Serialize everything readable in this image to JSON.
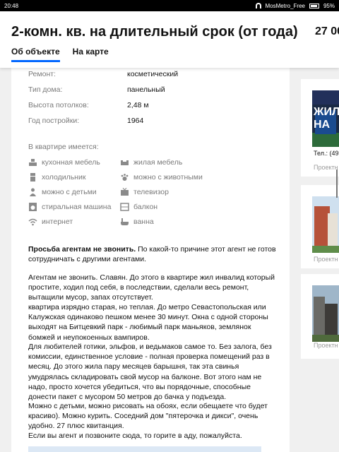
{
  "statusbar": {
    "time": "20:48",
    "network": "MosMetro_Free",
    "battery": "95%"
  },
  "header": {
    "title": "2-комн. кв. на длительный срок (от года)",
    "price": "27 00",
    "tabs": [
      {
        "label": "Об объекте"
      },
      {
        "label": "На карте"
      }
    ]
  },
  "details": [
    {
      "key": "Ремонт:",
      "value": "косметический"
    },
    {
      "key": "Тип дома:",
      "value": "панельный"
    },
    {
      "key": "Высота потолков:",
      "value": "2,48 м"
    },
    {
      "key": "Год постройки:",
      "value": "1964"
    }
  ],
  "amenities_title": "В квартире имеется:",
  "amenities": [
    {
      "label": "кухонная мебель",
      "icon": "kitchen-icon",
      "present": false
    },
    {
      "label": "жилая мебель",
      "icon": "sofa-icon",
      "present": false
    },
    {
      "label": "холодильник",
      "icon": "fridge-icon",
      "present": false
    },
    {
      "label": "можно с животными",
      "icon": "paw-icon",
      "present": false
    },
    {
      "label": "можно с детьми",
      "icon": "child-icon",
      "present": false
    },
    {
      "label": "телевизор",
      "icon": "tv-icon",
      "present": false
    },
    {
      "label": "стиральная машина",
      "icon": "washer-icon",
      "present": false
    },
    {
      "label": "балкон",
      "icon": "balcony-icon",
      "present": false
    },
    {
      "label": "интернет",
      "icon": "wifi-icon",
      "present": false
    },
    {
      "label": "ванна",
      "icon": "bathtub-icon",
      "present": false
    }
  ],
  "description": {
    "warning_bold": "Просьба агентам не звонить.",
    "warning_rest": " По какой-то причине этот агент не готов сотрудничать с другими агентами.",
    "paragraphs": [
      "Агентам не звонить. Славян. До этого в квартире жил инвалид который простите, ходил под себя, в последствии, сделали весь ремонт, вытащили мусор, запах отсутствует.",
      "квартира изрядно старая, но теплая. До метро Севастопольская или Калужская одинаково пешком менее 30 минут. Окна с одной стороны выходят на Битцевкий парк - любимый парк маньяков, землянок бомжей и неупокоенных вампиров.",
      "Для любителей готики, эльфов, и ведьмаков самое то. Без залога, без комиссии, единственное условие - полная проверка помещений раз в месяц. До этого жила пару месяцев барышня, так эта свинья умудрялась складировать свой мусор на балконе. Вот этого нам не надо, просто хочется убедиться, что вы порядочные, способные донести пакет с мусором 50 метров до бачка у подъезда.",
      "Можно с детьми, можно рисовать на обоях, если обещаете что будет красиво). Можно курить. Соседний дом \"пятерочка и дикси\", очень удобно. 27 плюс квитанция.",
      "Если вы агент и позвоните сюда, то горите в аду, пожалуйста."
    ]
  },
  "side_cards": [
    {
      "banner": "ЖИЛ НА",
      "tel": "Тел.: (495",
      "project": "Проектн"
    },
    {
      "project": "Проектн"
    },
    {
      "project": "Проектн"
    }
  ],
  "colors": {
    "accent": "#0468ff",
    "muted": "#7a7a7a",
    "text": "#121212"
  }
}
